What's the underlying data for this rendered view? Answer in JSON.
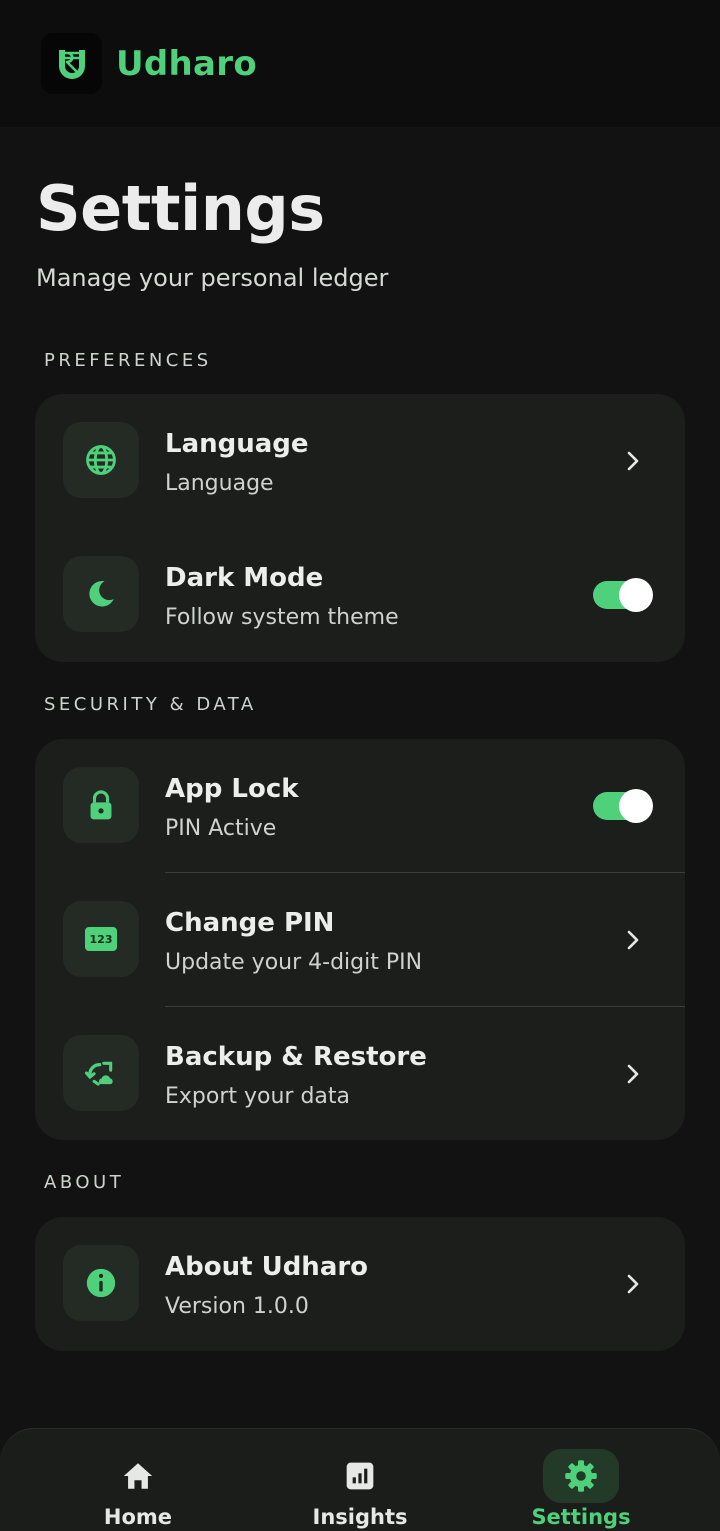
{
  "colors": {
    "accent": "#4fd07a",
    "background": "#121212",
    "card": "#1b1e1b",
    "icon_tile": "#242a24"
  },
  "app_bar": {
    "title": "Udharo",
    "logo_icon": "rupee-logo-icon"
  },
  "page": {
    "title": "Settings",
    "subtitle": "Manage your personal ledger"
  },
  "sections": {
    "preferences": {
      "label": "PREFERENCES",
      "items": [
        {
          "title": "Language",
          "subtitle": "Language",
          "icon": "globe-icon",
          "control": "chevron"
        },
        {
          "title": "Dark Mode",
          "subtitle": "Follow system theme",
          "icon": "moon-icon",
          "control": "toggle",
          "toggle_on": true
        }
      ]
    },
    "security": {
      "label": "SECURITY & DATA",
      "items": [
        {
          "title": "App Lock",
          "subtitle": "PIN Active",
          "icon": "lock-icon",
          "control": "toggle",
          "toggle_on": true
        },
        {
          "title": "Change PIN",
          "subtitle": "Update your 4-digit PIN",
          "icon": "pin-123-icon",
          "icon_text": "123",
          "control": "chevron"
        },
        {
          "title": "Backup & Restore",
          "subtitle": "Export your data",
          "icon": "backup-restore-icon",
          "control": "chevron"
        }
      ]
    },
    "about": {
      "label": "ABOUT",
      "items": [
        {
          "title": "About Udharo",
          "subtitle": "Version 1.0.0",
          "icon": "info-icon",
          "control": "chevron"
        }
      ]
    }
  },
  "bottom_nav": {
    "items": [
      {
        "label": "Home",
        "icon": "home-icon",
        "active": false
      },
      {
        "label": "Insights",
        "icon": "insights-icon",
        "active": false
      },
      {
        "label": "Settings",
        "icon": "gear-icon",
        "active": true
      }
    ]
  }
}
